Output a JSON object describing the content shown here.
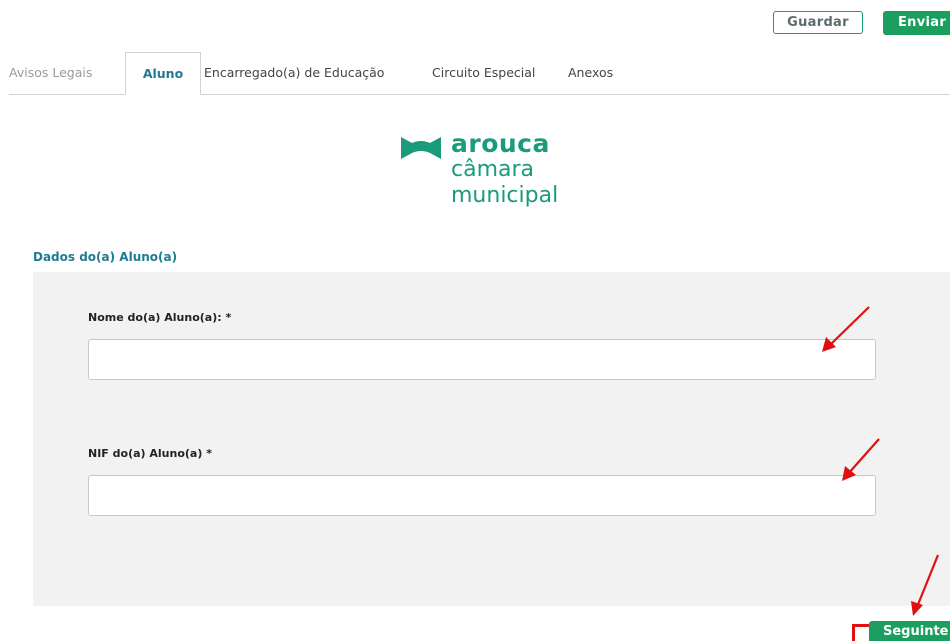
{
  "toolbar": {
    "save_label": "Guardar",
    "submit_label": "Enviar"
  },
  "tabs": [
    {
      "label": "Avisos Legais",
      "state": "muted"
    },
    {
      "label": "Aluno",
      "state": "active"
    },
    {
      "label": "Encarregado(a) de Educação",
      "state": "normal"
    },
    {
      "label": "Circuito Especial",
      "state": "normal"
    },
    {
      "label": "Anexos",
      "state": "normal"
    }
  ],
  "logo": {
    "line1": "arouca",
    "line2": "câmara",
    "line3": "municipal"
  },
  "section": {
    "title": "Dados do(a) Aluno(a)"
  },
  "fields": {
    "name_label": "Nome do(a) Aluno(a): *",
    "name_value": "",
    "nif_label": "NIF do(a) Aluno(a) *",
    "nif_value": ""
  },
  "footer": {
    "next_label": "Seguinte"
  },
  "colors": {
    "brand_green": "#1b9e5e",
    "tab_active": "#1e7b93",
    "logo_teal": "#1b9b7b",
    "annotation_red": "#e01010"
  }
}
